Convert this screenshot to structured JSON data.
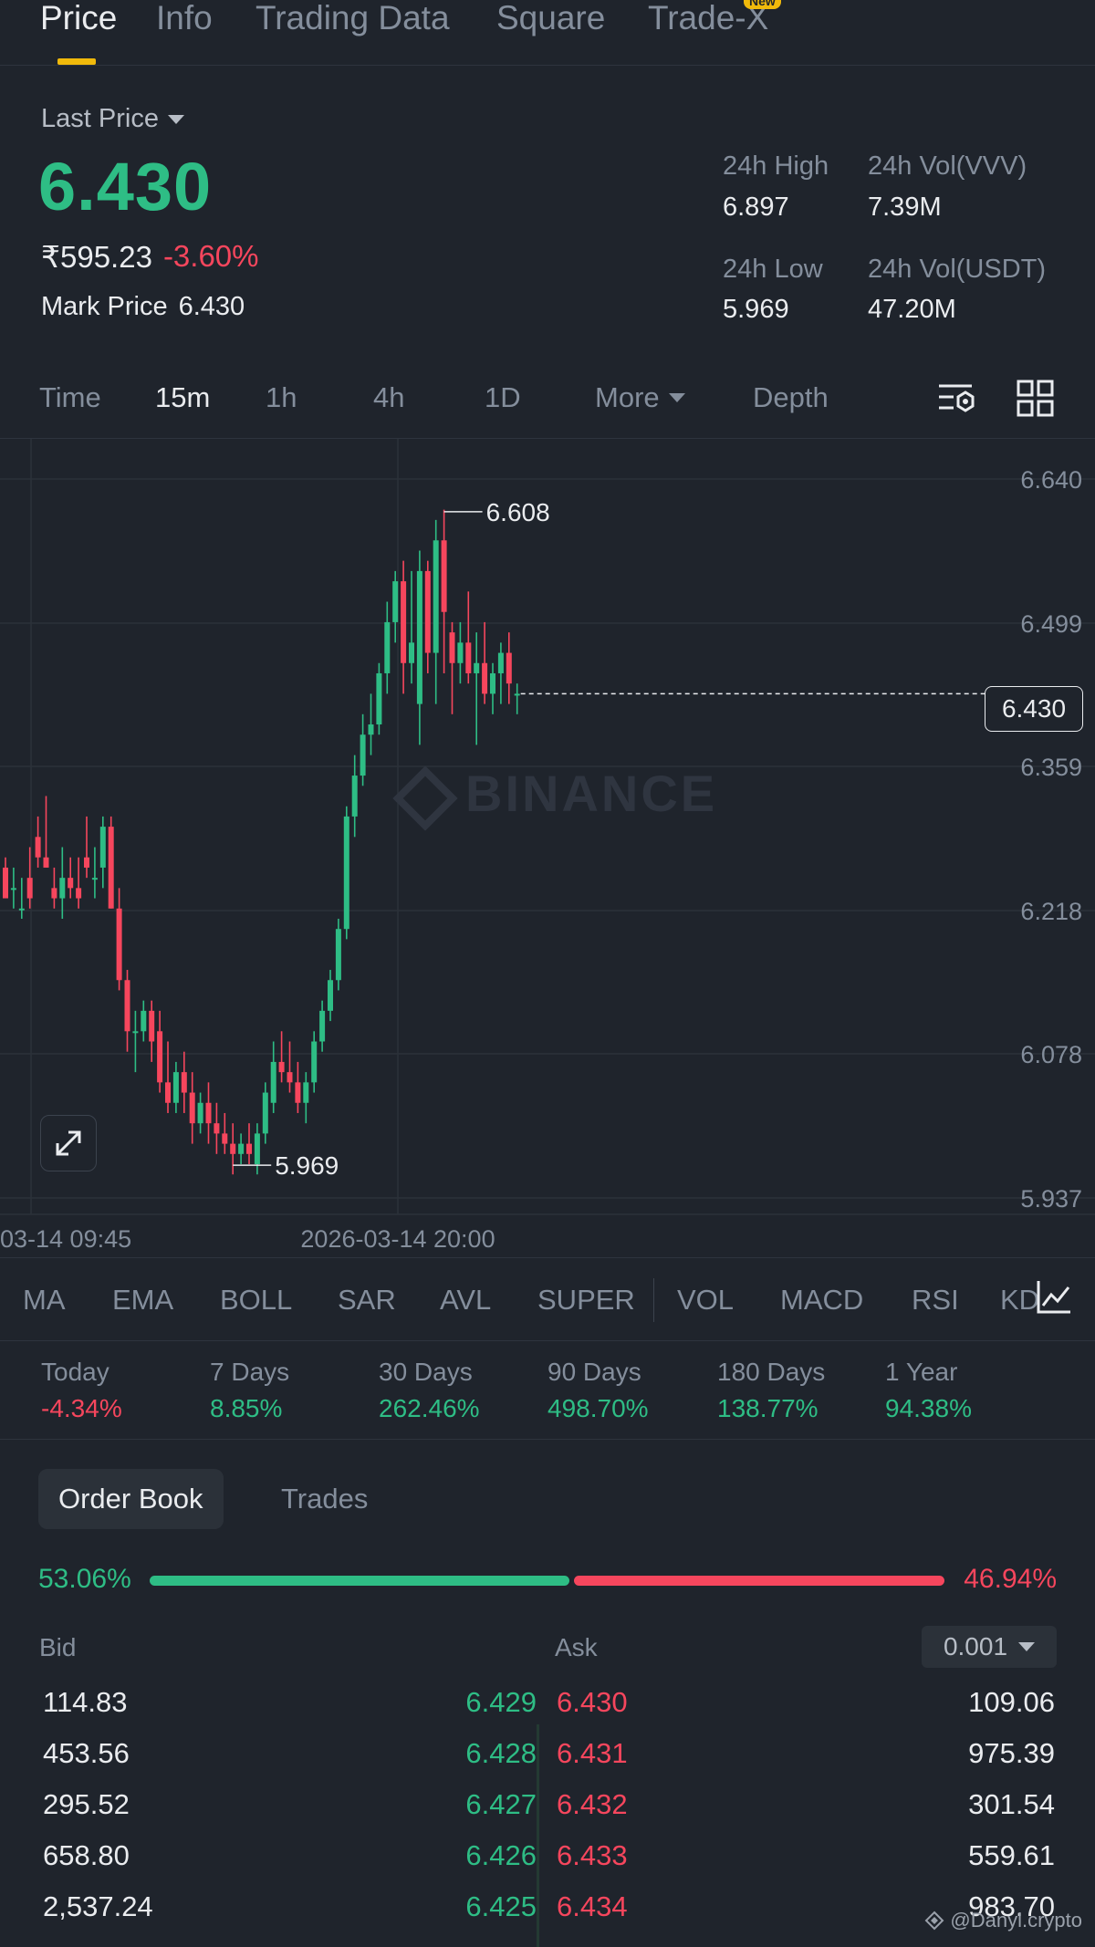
{
  "top_tabs": [
    "Price",
    "Info",
    "Trading Data",
    "Square",
    "Trade-X"
  ],
  "new_badge": "New",
  "header": {
    "last_price_label": "Last Price",
    "last_price": "6.430",
    "fiat_price": "₹595.23",
    "change_pct": "-3.60%",
    "mark_price_label": "Mark Price",
    "mark_price": "6.430",
    "high_label": "24h High",
    "high": "6.897",
    "vol_vvv_label": "24h Vol(VVV)",
    "vol_vvv": "7.39M",
    "low_label": "24h Low",
    "low": "5.969",
    "vol_usdt_label": "24h Vol(USDT)",
    "vol_usdt": "47.20M"
  },
  "intervals": [
    "Time",
    "15m",
    "1h",
    "4h",
    "1D",
    "More",
    "Depth"
  ],
  "active_interval": "15m",
  "icons": [
    "chart-settings-icon",
    "grid-layout-icon",
    "expand-icon",
    "indicator-chart-icon",
    "binance-logo-icon"
  ],
  "chart": {
    "y_ticks": [
      "6.640",
      "6.499",
      "6.359",
      "6.218",
      "6.078",
      "5.937"
    ],
    "x_ticks": [
      "03-14 09:45",
      "2026-03-14 20:00"
    ],
    "high_marker": "6.608",
    "low_marker": "5.969",
    "current_price_tag": "6.430",
    "watermark": "BINANCE"
  },
  "chart_data": {
    "type": "candlestick",
    "xlabel": "",
    "ylabel": "",
    "ylim": [
      5.937,
      6.64
    ],
    "current_price": 6.43,
    "marked_high": 6.608,
    "marked_low": 5.969,
    "x_tick_labels": [
      "03-14 09:45",
      "2026-03-14 20:00"
    ],
    "up_color": "#2ebd85",
    "down_color": "#f6465d",
    "candles": [
      [
        6.26,
        6.27,
        6.24,
        6.23
      ],
      [
        6.24,
        6.26,
        6.22,
        6.24
      ],
      [
        6.22,
        6.25,
        6.21,
        6.22
      ],
      [
        6.25,
        6.28,
        6.22,
        6.23
      ],
      [
        6.29,
        6.31,
        6.26,
        6.27
      ],
      [
        6.27,
        6.33,
        6.26,
        6.26
      ],
      [
        6.24,
        6.26,
        6.22,
        6.23
      ],
      [
        6.23,
        6.28,
        6.21,
        6.25
      ],
      [
        6.25,
        6.27,
        6.23,
        6.24
      ],
      [
        6.24,
        6.27,
        6.22,
        6.23
      ],
      [
        6.27,
        6.31,
        6.25,
        6.26
      ],
      [
        6.25,
        6.28,
        6.23,
        6.25
      ],
      [
        6.26,
        6.31,
        6.24,
        6.3
      ],
      [
        6.3,
        6.31,
        6.22,
        6.22
      ],
      [
        6.22,
        6.24,
        6.14,
        6.15
      ],
      [
        6.15,
        6.16,
        6.08,
        6.1
      ],
      [
        6.1,
        6.12,
        6.06,
        6.1
      ],
      [
        6.1,
        6.13,
        6.09,
        6.12
      ],
      [
        6.12,
        6.13,
        6.07,
        6.09
      ],
      [
        6.1,
        6.12,
        6.04,
        6.05
      ],
      [
        6.05,
        6.09,
        6.02,
        6.03
      ],
      [
        6.03,
        6.07,
        6.02,
        6.06
      ],
      [
        6.06,
        6.08,
        6.02,
        6.04
      ],
      [
        6.04,
        6.06,
        5.99,
        6.01
      ],
      [
        6.01,
        6.04,
        6.0,
        6.03
      ],
      [
        6.03,
        6.05,
        5.99,
        6.01
      ],
      [
        6.01,
        6.03,
        5.98,
        6.0
      ],
      [
        6.0,
        6.02,
        5.98,
        5.99
      ],
      [
        5.99,
        6.01,
        5.96,
        5.98
      ],
      [
        5.98,
        6.0,
        5.97,
        5.99
      ],
      [
        5.99,
        6.01,
        5.97,
        5.98
      ],
      [
        5.97,
        6.01,
        5.96,
        6.0
      ],
      [
        6.0,
        6.05,
        5.99,
        6.04
      ],
      [
        6.03,
        6.09,
        6.02,
        6.07
      ],
      [
        6.07,
        6.1,
        6.05,
        6.06
      ],
      [
        6.06,
        6.09,
        6.04,
        6.05
      ],
      [
        6.05,
        6.07,
        6.02,
        6.03
      ],
      [
        6.03,
        6.06,
        6.01,
        6.05
      ],
      [
        6.05,
        6.1,
        6.04,
        6.09
      ],
      [
        6.09,
        6.13,
        6.08,
        6.12
      ],
      [
        6.12,
        6.16,
        6.11,
        6.15
      ],
      [
        6.15,
        6.21,
        6.14,
        6.2
      ],
      [
        6.2,
        6.32,
        6.19,
        6.31
      ],
      [
        6.31,
        6.37,
        6.29,
        6.35
      ],
      [
        6.35,
        6.41,
        6.34,
        6.39
      ],
      [
        6.39,
        6.43,
        6.37,
        6.4
      ],
      [
        6.4,
        6.46,
        6.39,
        6.45
      ],
      [
        6.45,
        6.52,
        6.43,
        6.5
      ],
      [
        6.5,
        6.55,
        6.48,
        6.54
      ],
      [
        6.54,
        6.56,
        6.43,
        6.46
      ],
      [
        6.46,
        6.55,
        6.44,
        6.48
      ],
      [
        6.42,
        6.57,
        6.38,
        6.55
      ],
      [
        6.55,
        6.56,
        6.45,
        6.47
      ],
      [
        6.47,
        6.6,
        6.42,
        6.58
      ],
      [
        6.58,
        6.61,
        6.45,
        6.51
      ],
      [
        6.49,
        6.5,
        6.41,
        6.46
      ],
      [
        6.46,
        6.5,
        6.44,
        6.48
      ],
      [
        6.48,
        6.53,
        6.44,
        6.45
      ],
      [
        6.45,
        6.49,
        6.38,
        6.46
      ],
      [
        6.46,
        6.5,
        6.42,
        6.43
      ],
      [
        6.43,
        6.46,
        6.41,
        6.45
      ],
      [
        6.45,
        6.48,
        6.42,
        6.47
      ],
      [
        6.47,
        6.49,
        6.42,
        6.44
      ],
      [
        6.43,
        6.44,
        6.41,
        6.43
      ]
    ]
  },
  "indicators": [
    "MA",
    "EMA",
    "BOLL",
    "SAR",
    "AVL",
    "SUPER",
    "VOL",
    "MACD",
    "RSI",
    "KD"
  ],
  "performance": [
    {
      "label": "Today",
      "value": "-4.34%"
    },
    {
      "label": "7 Days",
      "value": "8.85%"
    },
    {
      "label": "30 Days",
      "value": "262.46%"
    },
    {
      "label": "90 Days",
      "value": "498.70%"
    },
    {
      "label": "180 Days",
      "value": "138.77%"
    },
    {
      "label": "1 Year",
      "value": "94.38%"
    }
  ],
  "order_book": {
    "tabs": [
      "Order Book",
      "Trades"
    ],
    "bid_pct": "53.06%",
    "ask_pct": "46.94%",
    "bid_ratio": 0.5306,
    "bid_header": "Bid",
    "ask_header": "Ask",
    "precision": "0.001",
    "rows": [
      {
        "bid_qty": "114.83",
        "bid_price": "6.429",
        "ask_price": "6.430",
        "ask_qty": "109.06"
      },
      {
        "bid_qty": "453.56",
        "bid_price": "6.428",
        "ask_price": "6.431",
        "ask_qty": "975.39"
      },
      {
        "bid_qty": "295.52",
        "bid_price": "6.427",
        "ask_price": "6.432",
        "ask_qty": "301.54"
      },
      {
        "bid_qty": "658.80",
        "bid_price": "6.426",
        "ask_price": "6.433",
        "ask_qty": "559.61"
      },
      {
        "bid_qty": "2,537.24",
        "bid_price": "6.425",
        "ask_price": "6.434",
        "ask_qty": "983.70"
      }
    ]
  },
  "footer_watermark": "@Danyl.crypto"
}
